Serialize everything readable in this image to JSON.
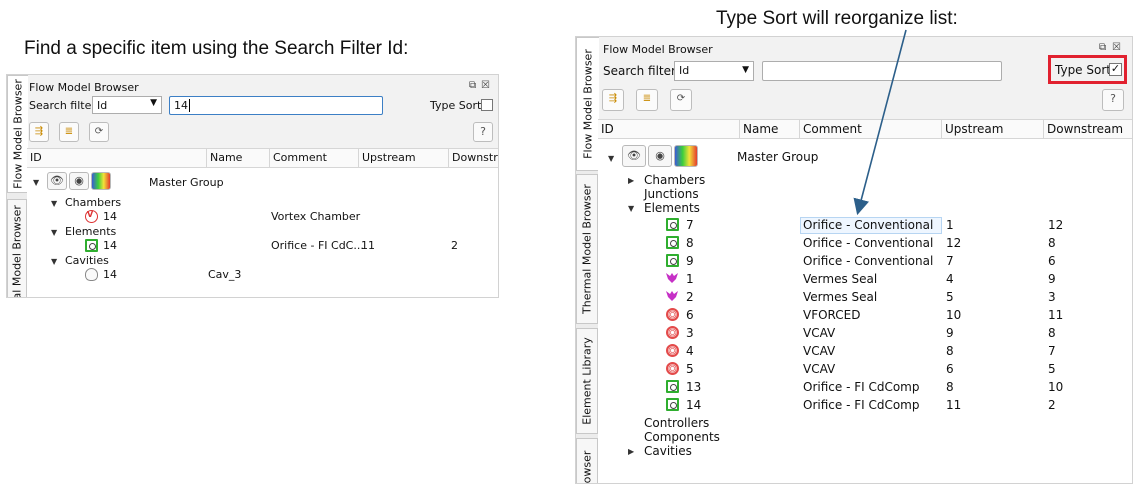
{
  "captions": {
    "left": "Find a specific item using the Search Filter Id:",
    "right": "Type Sort will reorganize list:"
  },
  "left_panel": {
    "title": "Flow Model Browser",
    "side_tabs": [
      "Flow Model Browser",
      "Thermal Model Browser"
    ],
    "search_label": "Search filter",
    "search_field_value": "Id",
    "search_text": "14",
    "type_sort_label": "Type Sort",
    "type_sort_checked": false,
    "help_label": "?",
    "columns": [
      "ID",
      "Name",
      "Comment",
      "Upstream",
      "Downstream"
    ],
    "master_group": "Master Group",
    "tree": [
      {
        "label": "Chambers",
        "children": [
          {
            "icon": "vortex-chamber-icon",
            "id": "14",
            "name": "",
            "comment": "Vortex Chamber",
            "upstream": "",
            "downstream": ""
          }
        ]
      },
      {
        "label": "Elements",
        "children": [
          {
            "icon": "orifice-icon",
            "id": "14",
            "name": "",
            "comment": "Orifice - FI CdC...",
            "upstream": "11",
            "downstream": "2"
          }
        ]
      },
      {
        "label": "Cavities",
        "children": [
          {
            "icon": "cavity-icon",
            "id": "14",
            "name": "Cav_3",
            "comment": "",
            "upstream": "",
            "downstream": ""
          }
        ]
      }
    ]
  },
  "right_panel": {
    "title": "Flow Model Browser",
    "side_tabs": [
      "Flow Model Browser",
      "Thermal Model Browser",
      "Element Library",
      "owser"
    ],
    "search_label": "Search filter",
    "search_field_value": "Id",
    "search_text": "",
    "type_sort_label": "Type Sort",
    "type_sort_checked": true,
    "type_sort_check_glyph": "✓",
    "help_label": "?",
    "columns": [
      "ID",
      "Name",
      "Comment",
      "Upstream",
      "Downstream"
    ],
    "master_group": "Master Group",
    "groups": [
      "Chambers",
      "Junctions",
      "Elements",
      "Controllers",
      "Components",
      "Cavities"
    ],
    "elements": [
      {
        "icon": "orifice-icon",
        "id": "7",
        "comment": "Orifice - Conventional",
        "upstream": "1",
        "downstream": "12"
      },
      {
        "icon": "orifice-icon",
        "id": "8",
        "comment": "Orifice - Conventional",
        "upstream": "12",
        "downstream": "8"
      },
      {
        "icon": "orifice-icon",
        "id": "9",
        "comment": "Orifice - Conventional",
        "upstream": "7",
        "downstream": "6"
      },
      {
        "icon": "vermes-seal-icon",
        "id": "1",
        "comment": "Vermes Seal",
        "upstream": "4",
        "downstream": "9"
      },
      {
        "icon": "vermes-seal-icon",
        "id": "2",
        "comment": "Vermes Seal",
        "upstream": "5",
        "downstream": "3"
      },
      {
        "icon": "vcav-icon",
        "id": "6",
        "comment": "VFORCED",
        "upstream": "10",
        "downstream": "11"
      },
      {
        "icon": "vcav-icon",
        "id": "3",
        "comment": "VCAV",
        "upstream": "9",
        "downstream": "8"
      },
      {
        "icon": "vcav-icon",
        "id": "4",
        "comment": "VCAV",
        "upstream": "8",
        "downstream": "7"
      },
      {
        "icon": "vcav-icon",
        "id": "5",
        "comment": "VCAV",
        "upstream": "6",
        "downstream": "5"
      },
      {
        "icon": "orifice-icon",
        "id": "13",
        "comment": "Orifice - FI CdComp",
        "upstream": "8",
        "downstream": "10"
      },
      {
        "icon": "orifice-icon",
        "id": "14",
        "comment": "Orifice - FI CdComp",
        "upstream": "11",
        "downstream": "2"
      }
    ]
  },
  "colors": {
    "highlight_box": "#e1212f",
    "arrow": "#2c5f8a",
    "orifice_icon": "#2fae2f",
    "vcav_icon": "#e34a4a",
    "seal_icon": "#c630c6"
  }
}
